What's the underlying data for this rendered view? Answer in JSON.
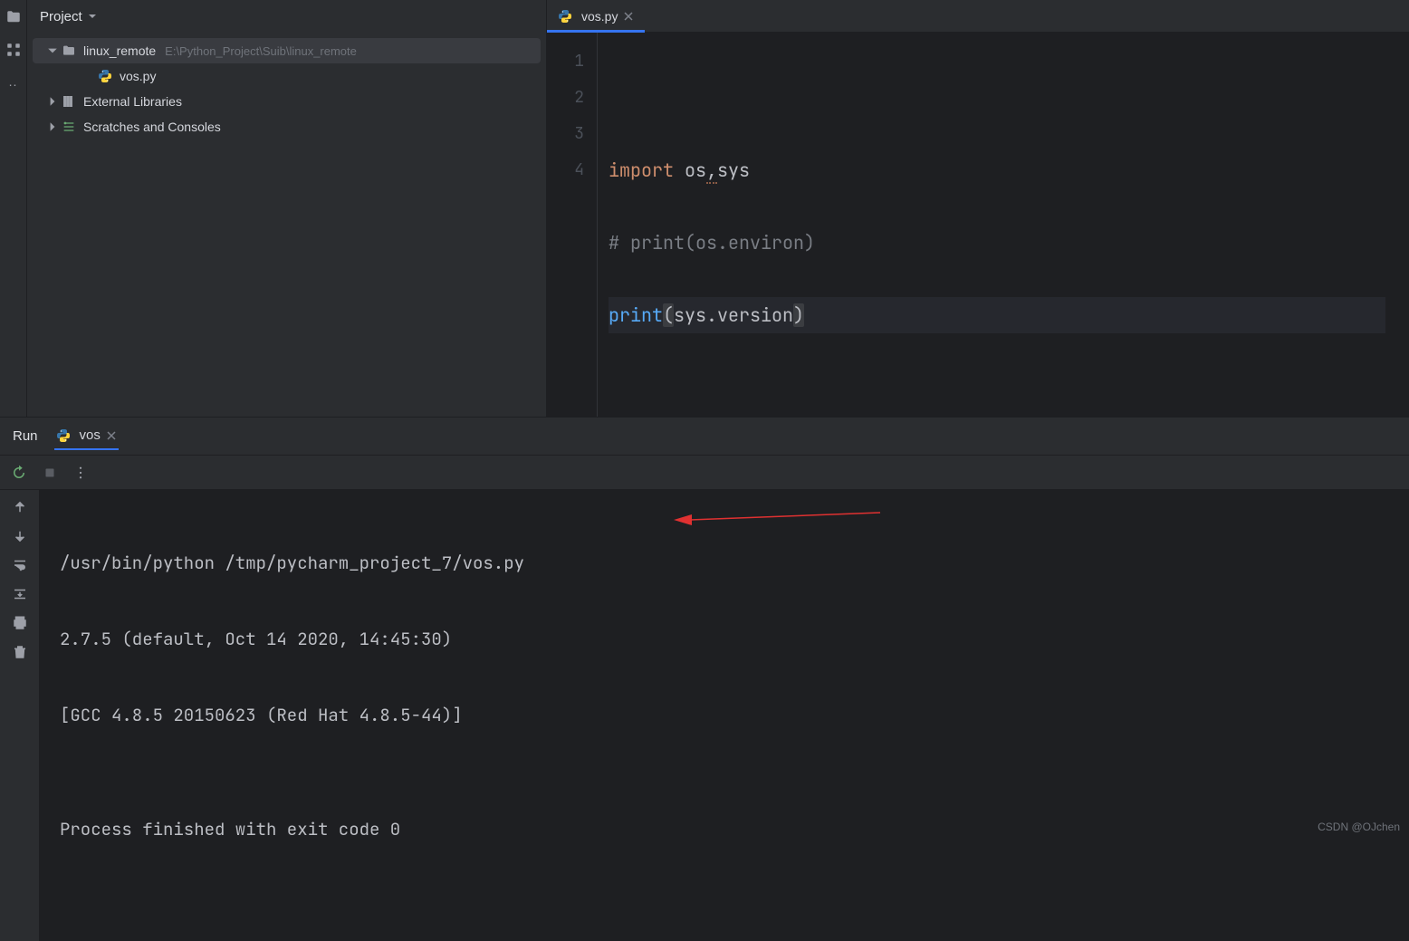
{
  "sidebar": {
    "title": "Project",
    "tree": {
      "root": {
        "name": "linux_remote",
        "path": "E:\\Python_Project\\Suib\\linux_remote"
      },
      "file": {
        "name": "vos.py"
      },
      "external": "External Libraries",
      "scratches": "Scratches and Consoles"
    }
  },
  "editor": {
    "tab_name": "vos.py",
    "line_numbers": [
      "1",
      "2",
      "3",
      "4"
    ],
    "code": {
      "l2": {
        "kw": "import",
        "mods": "os",
        "comma": ",",
        "mods2": "sys"
      },
      "l3": "# print(os.environ)",
      "l4": {
        "fn": "print",
        "lp": "(",
        "arg": "sys.version",
        "rp": ")"
      }
    }
  },
  "run": {
    "title": "Run",
    "tab": "vos",
    "output": {
      "l1": "/usr/bin/python /tmp/pycharm_project_7/vos.py",
      "l2": "2.7.5 (default, Oct 14 2020, 14:45:30) ",
      "l3": "[GCC 4.8.5 20150623 (Red Hat 4.8.5-44)]",
      "l4": "",
      "l5": "Process finished with exit code 0"
    }
  },
  "watermark": "CSDN @OJchen"
}
